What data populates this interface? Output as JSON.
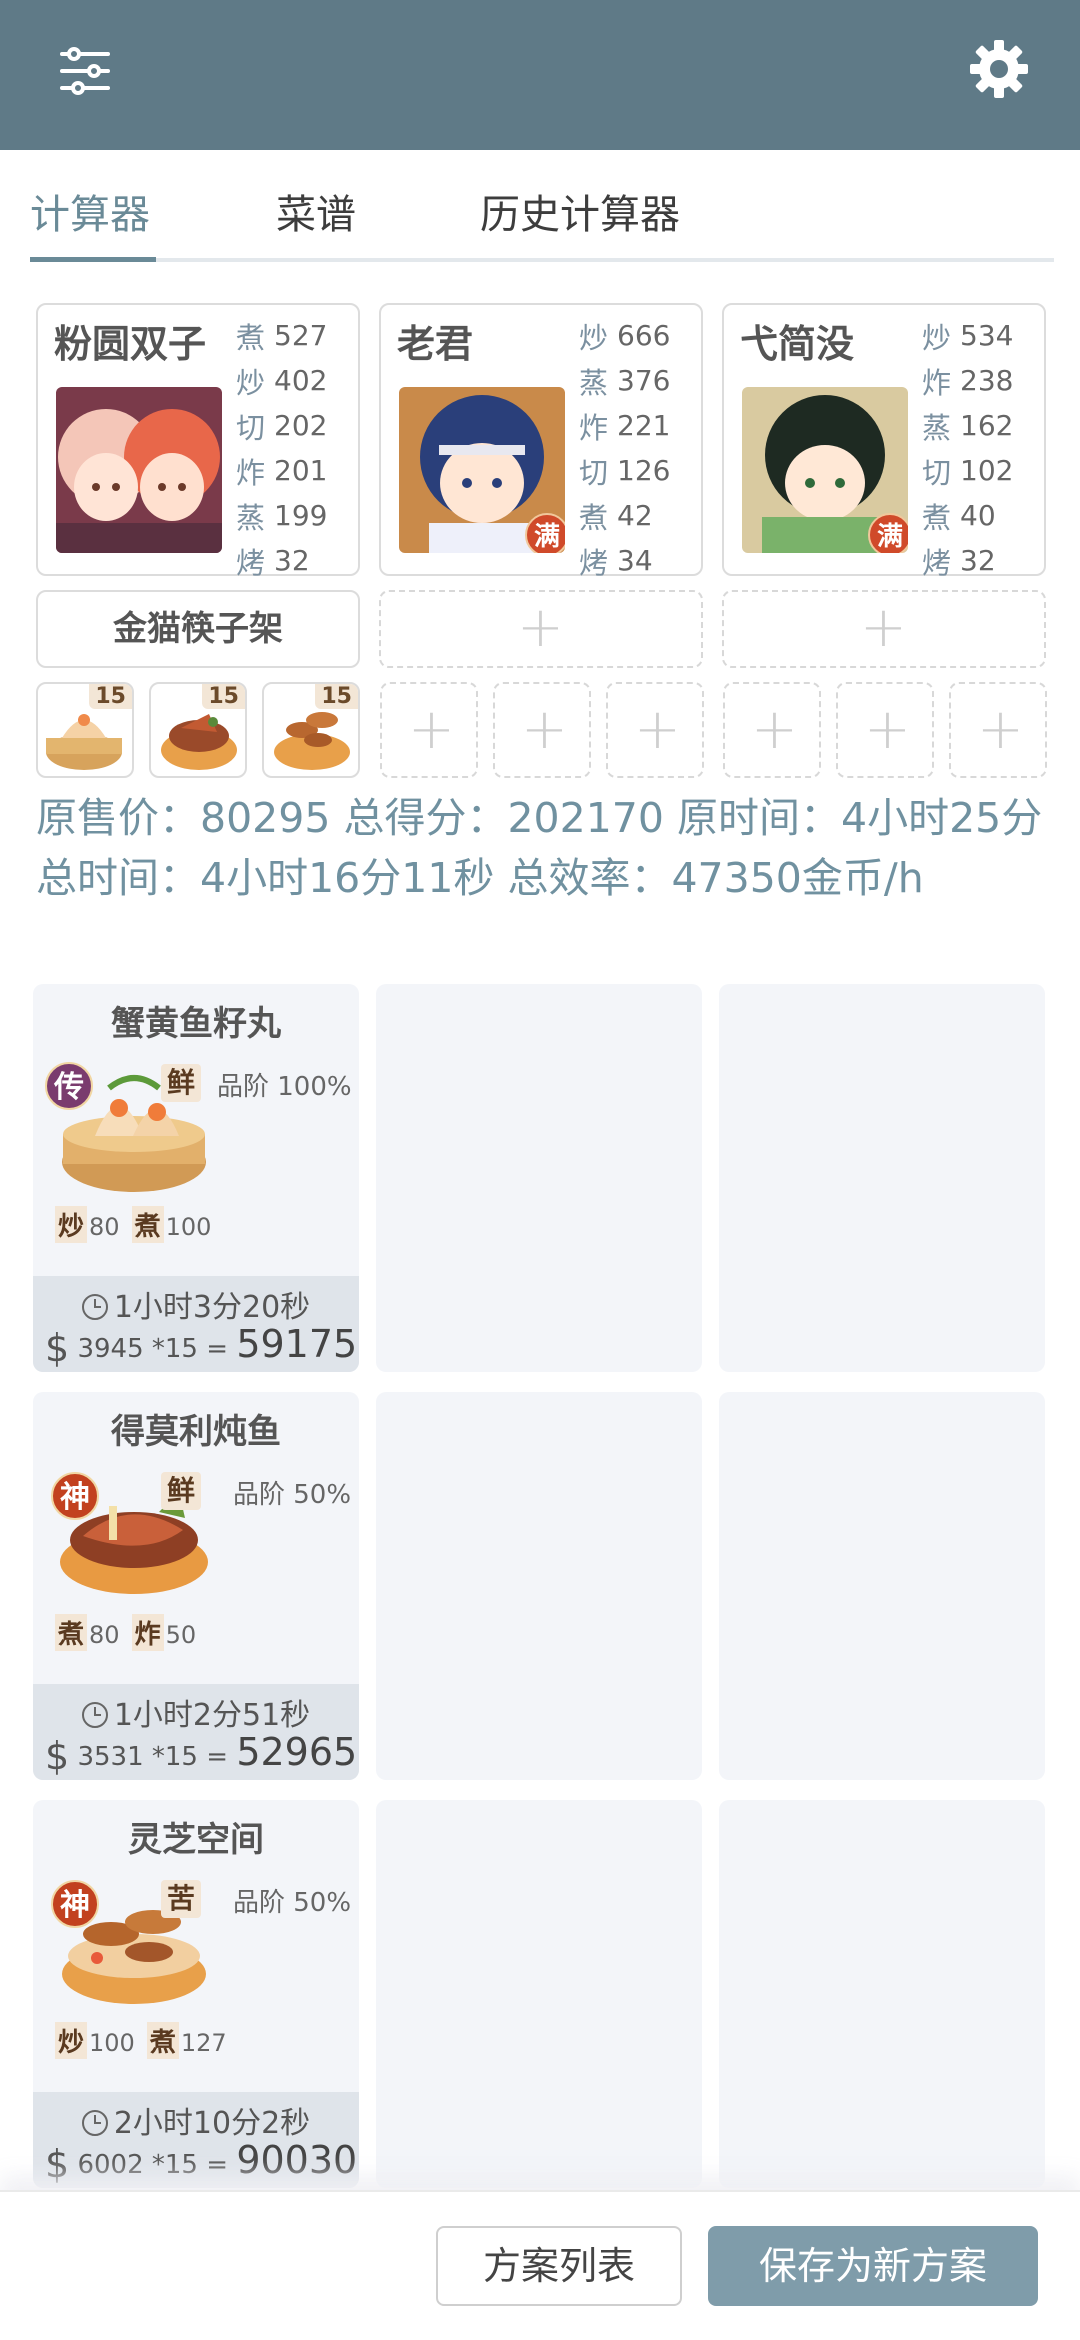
{
  "tabs": [
    {
      "label": "计算器"
    },
    {
      "label": "菜谱"
    },
    {
      "label": "历史计算器"
    }
  ],
  "chefs": [
    {
      "name": "粉圆双子",
      "full": "",
      "stats": [
        {
          "k": "煮",
          "v": "527"
        },
        {
          "k": "炒",
          "v": "402"
        },
        {
          "k": "切",
          "v": "202"
        },
        {
          "k": "炸",
          "v": "201"
        },
        {
          "k": "蒸",
          "v": "199"
        },
        {
          "k": "烤",
          "v": "32"
        }
      ]
    },
    {
      "name": "老君",
      "full": "满",
      "stats": [
        {
          "k": "炒",
          "v": "666"
        },
        {
          "k": "蒸",
          "v": "376"
        },
        {
          "k": "炸",
          "v": "221"
        },
        {
          "k": "切",
          "v": "126"
        },
        {
          "k": "煮",
          "v": "42"
        },
        {
          "k": "烤",
          "v": "34"
        }
      ]
    },
    {
      "name": "弋简没",
      "full": "满",
      "stats": [
        {
          "k": "炒",
          "v": "534"
        },
        {
          "k": "炸",
          "v": "238"
        },
        {
          "k": "蒸",
          "v": "162"
        },
        {
          "k": "切",
          "v": "102"
        },
        {
          "k": "煮",
          "v": "40"
        },
        {
          "k": "烤",
          "v": "32"
        }
      ]
    }
  ],
  "equipment": {
    "label": "金猫筷子架"
  },
  "slots": [
    {
      "count": "15"
    },
    {
      "count": "15"
    },
    {
      "count": "15"
    }
  ],
  "summary": {
    "text": "原售价：80295 总得分：202170 原时间：4小时25分 总时间：4小时16分11秒 总效率：47350金币/h"
  },
  "dishes": [
    {
      "name": "蟹黄鱼籽丸",
      "rarity": "传",
      "flavor": "鲜",
      "grade": "品阶 100%",
      "skills": [
        {
          "k": "炒",
          "v": "80"
        },
        {
          "k": "煮",
          "v": "100"
        }
      ],
      "time": "1小时3分20秒",
      "price": "3945 *15",
      "total": "59175",
      "eq": "="
    },
    {
      "name": "得莫利炖鱼",
      "rarity": "神",
      "flavor": "鲜",
      "grade": "品阶 50%",
      "skills": [
        {
          "k": "煮",
          "v": "80"
        },
        {
          "k": "炸",
          "v": "50"
        }
      ],
      "time": "1小时2分51秒",
      "price": "3531 *15",
      "total": "52965",
      "eq": "="
    },
    {
      "name": "灵芝空间",
      "rarity": "神",
      "flavor": "苦",
      "grade": "品阶 50%",
      "skills": [
        {
          "k": "炒",
          "v": "100"
        },
        {
          "k": "煮",
          "v": "127"
        }
      ],
      "time": "2小时10分2秒",
      "price": "6002 *15",
      "total": "90030",
      "eq": "="
    }
  ],
  "buttons": {
    "list": "方案列表",
    "save": "保存为新方案"
  },
  "colors": {
    "topbar": "#5f7a87",
    "accent": "#6a8a97",
    "summary": "#7091a0",
    "save": "#7f9caa",
    "rarity_legend": "#7a3b6e",
    "rarity_god": "#c2411f"
  },
  "icons": {
    "menu": "sliders-icon",
    "settings": "gear-icon",
    "clock": "clock-icon",
    "plus": "plus-icon"
  }
}
